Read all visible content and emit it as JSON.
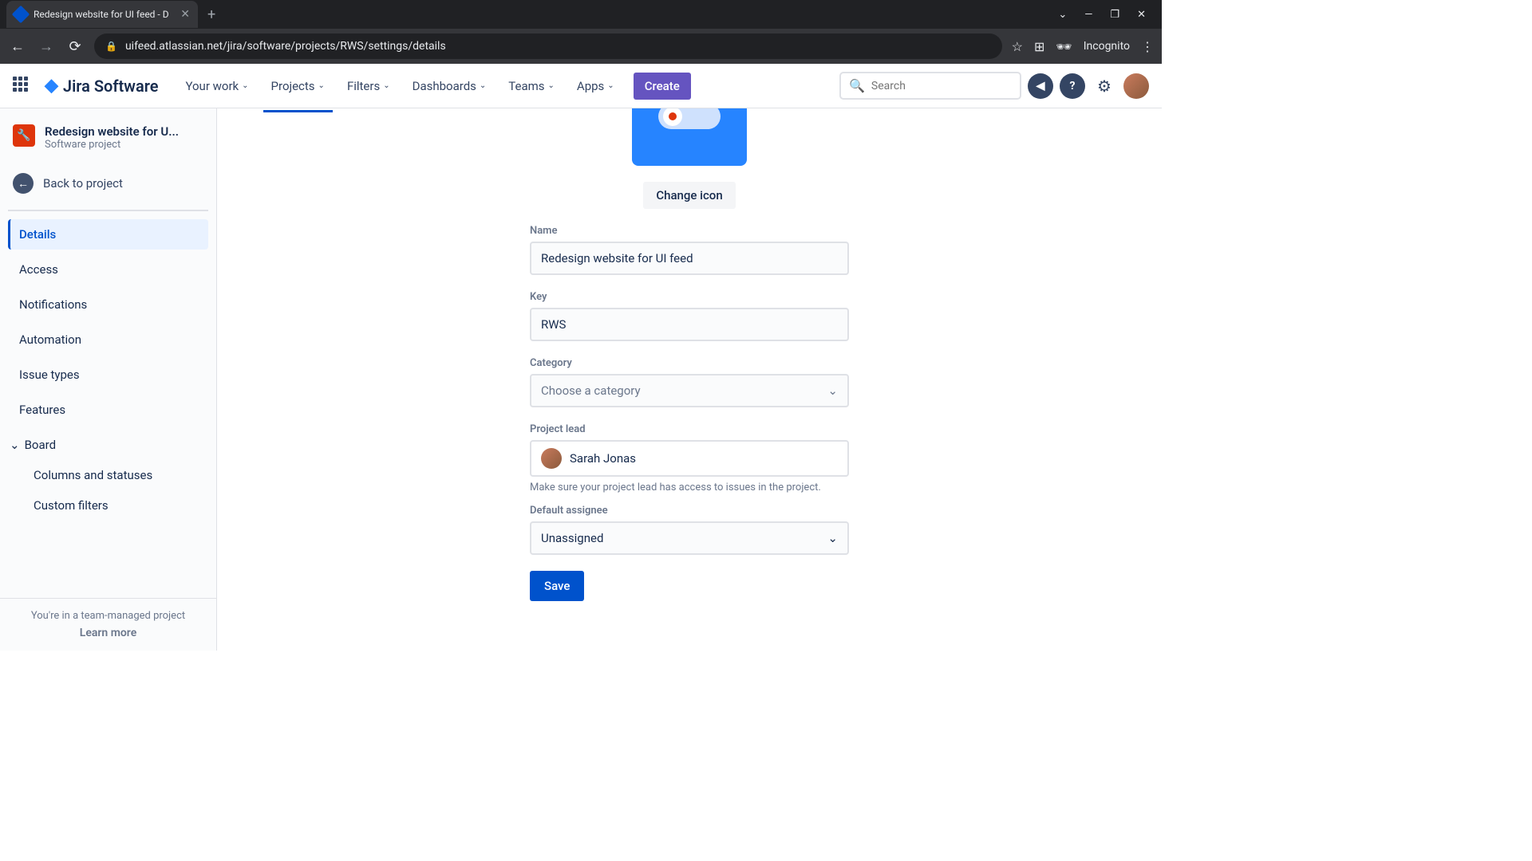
{
  "browser": {
    "tab_title": "Redesign website for UI feed - D",
    "url": "uifeed.atlassian.net/jira/software/projects/RWS/settings/details",
    "incognito_label": "Incognito"
  },
  "header": {
    "product": "Jira Software",
    "nav": {
      "your_work": "Your work",
      "projects": "Projects",
      "filters": "Filters",
      "dashboards": "Dashboards",
      "teams": "Teams",
      "apps": "Apps"
    },
    "create": "Create",
    "search_placeholder": "Search"
  },
  "sidebar": {
    "project_name": "Redesign website for U...",
    "project_type": "Software project",
    "back_label": "Back to project",
    "menu": {
      "details": "Details",
      "access": "Access",
      "notifications": "Notifications",
      "automation": "Automation",
      "issue_types": "Issue types",
      "features": "Features",
      "board": "Board",
      "columns": "Columns and statuses",
      "custom_filters": "Custom filters"
    },
    "footer_text": "You're in a team-managed project",
    "learn_more": "Learn more"
  },
  "form": {
    "change_icon": "Change icon",
    "name_label": "Name",
    "name_value": "Redesign website for UI feed",
    "key_label": "Key",
    "key_value": "RWS",
    "category_label": "Category",
    "category_placeholder": "Choose a category",
    "lead_label": "Project lead",
    "lead_value": "Sarah Jonas",
    "lead_help": "Make sure your project lead has access to issues in the project.",
    "assignee_label": "Default assignee",
    "assignee_value": "Unassigned",
    "save": "Save"
  }
}
